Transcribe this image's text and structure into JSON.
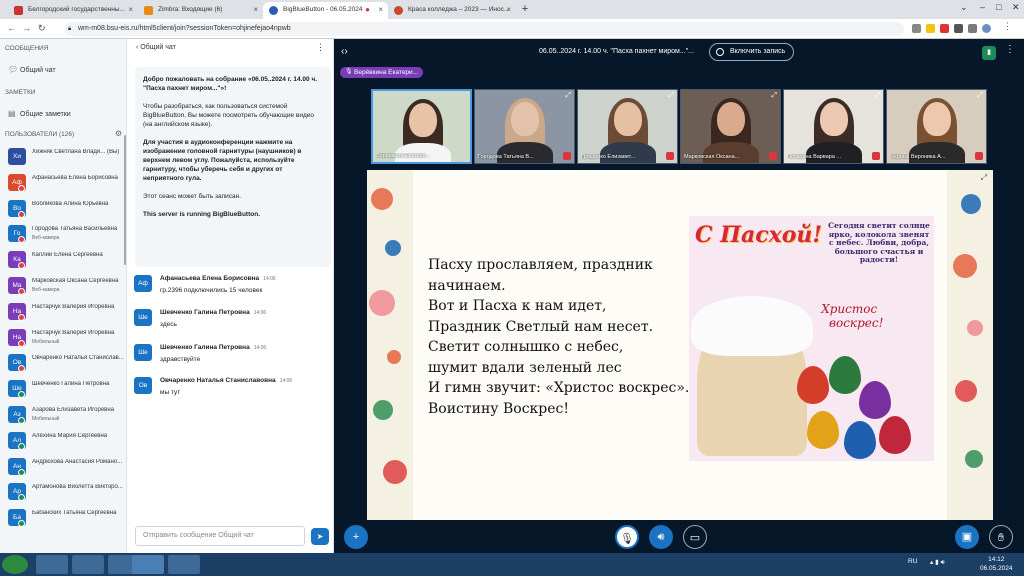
{
  "browser": {
    "tabs": [
      {
        "title": "Белгородский государственны...",
        "active": false
      },
      {
        "title": "Zimbra: Входящие (6)",
        "active": false
      },
      {
        "title": "BigBlueButton - 06.05.2024",
        "active": true
      },
      {
        "title": "Краса колледжа – 2023 — Инос...",
        "active": false
      }
    ],
    "url": "wm-m08.bsu-eis.ru/html5client/join?sessionToken=ohjinefejao4npwb"
  },
  "sidebar": {
    "messages_header": "СООБЩЕНИЯ",
    "public_chat": "Общий чат",
    "notes_header": "ЗАМЕТКИ",
    "shared_notes": "Общие заметки",
    "users_header": "ПОЛЬЗОВАТЕЛИ (126)",
    "users": [
      {
        "initials": "Хи",
        "name": "Хижняк Светлана Влади... (Вы)",
        "sub": "",
        "color": "#2b4ea0",
        "status": "none"
      },
      {
        "initials": "Аф",
        "name": "Афанасьева Елена Борисовна",
        "sub": "",
        "color": "#d94b2b",
        "status": "red"
      },
      {
        "initials": "Во",
        "name": "Вобликова Алина Юрьевна",
        "sub": "",
        "color": "#1b73c3",
        "status": "red"
      },
      {
        "initials": "Го",
        "name": "Городова Татьяна Васильевна",
        "sub": "Веб-камера",
        "color": "#1b73c3",
        "status": "red"
      },
      {
        "initials": "Ка",
        "name": "Каплий Елена Сергеевна",
        "sub": "",
        "color": "#7a3db8",
        "status": "red"
      },
      {
        "initials": "Ма",
        "name": "Марковская Оксана Сергеевна",
        "sub": "Веб-камера",
        "color": "#7a3db8",
        "status": "red"
      },
      {
        "initials": "На",
        "name": "Настарчук Валерия Игоревна",
        "sub": "",
        "color": "#7a3db8",
        "status": "red"
      },
      {
        "initials": "На",
        "name": "Настарчук Валерия Игоревна",
        "sub": "Мобильный",
        "color": "#7a3db8",
        "status": "red"
      },
      {
        "initials": "Ов",
        "name": "Овчаренко Наталья Станислав...",
        "sub": "",
        "color": "#1b73c3",
        "status": "red"
      },
      {
        "initials": "Ше",
        "name": "Шевченко Галина Петровна",
        "sub": "",
        "color": "#1b73c3",
        "status": "green"
      },
      {
        "initials": "Аз",
        "name": "Азарова Елизавета Игоревна",
        "sub": "Мобильный",
        "color": "#1b73c3",
        "status": "green"
      },
      {
        "initials": "Ал",
        "name": "Алёхина Мария Сергеевна",
        "sub": "",
        "color": "#1b73c3",
        "status": "green"
      },
      {
        "initials": "Ан",
        "name": "Андрюхова Анастасия Романо...",
        "sub": "",
        "color": "#1b73c3",
        "status": "green"
      },
      {
        "initials": "Ар",
        "name": "Артамонова Виолетта Викторо...",
        "sub": "",
        "color": "#1b73c3",
        "status": "green"
      },
      {
        "initials": "Ба",
        "name": "Бабанских Татьяна Сергеевна",
        "sub": "",
        "color": "#1b73c3",
        "status": "green"
      }
    ]
  },
  "chat": {
    "title": "Общий чат",
    "welcome": [
      "Добро пожаловать на собрание «06.05..2024 г. 14.00 ч. \"Пасха пахнет миром...\"»!",
      "Чтобы разобраться, как пользоваться системой BigBlueButton, Вы можете посмотреть обучающие видео (на английском языке).",
      "Для участия в аудиоконференции нажмите на изображение головной гарнитуры (наушников) в верхнем левом углу. Пожалуйста, используйте гарнитуру, чтобы уберечь себя и других от неприятного гула.",
      "Этот сеанс может быть записан.",
      "This server is running BigBlueButton."
    ],
    "messages": [
      {
        "initials": "Аф",
        "author": "Афанасьева Елена Борисовна",
        "time": "14:06",
        "text": "гр.2396 подключились 15 человек"
      },
      {
        "initials": "Ше",
        "author": "Шевченко Галина Петровна",
        "time": "14:06",
        "text": "здесь"
      },
      {
        "initials": "Ше",
        "author": "Шевченко Галина Петровна",
        "time": "14:06",
        "text": "здравствуйте"
      },
      {
        "initials": "Ов",
        "author": "Овчаренко Наталья Станиславовна",
        "time": "14:06",
        "text": "мы тут"
      }
    ],
    "input_placeholder": "Отправить сообщение Общий чат"
  },
  "stage": {
    "meeting_title": "06.05..2024 г. 14.00 ч. \"Пасха пахнет миром...\"...",
    "record_label": "Включить запись",
    "talking": "Верёвкина Екатери...",
    "videos": [
      {
        "name": "Верёвкина Екатери...",
        "bg": "#cfd9c8",
        "hair": "#3b2a22",
        "skin": "#e8c3a8",
        "shirt": "#f5f5f5"
      },
      {
        "name": "Городова Татьяна В...",
        "bg": "#8b95a3",
        "hair": "#caa98a",
        "skin": "#e2c2aa",
        "shirt": "#2a2a2e"
      },
      {
        "name": "Грищенко Елизавет...",
        "bg": "#cdd2cc",
        "hair": "#6b4a36",
        "skin": "#e5c0a2",
        "shirt": "#2f3a4a"
      },
      {
        "name": "Марковская Оксана...",
        "bg": "#6c5e55",
        "hair": "#3a2720",
        "skin": "#d9ab8c",
        "shirt": "#5a3d2e"
      },
      {
        "name": "Потапина Варвара ...",
        "bg": "#e6e2dc",
        "hair": "#3d2c25",
        "skin": "#ecc9b2",
        "shirt": "#1f1f24"
      },
      {
        "name": "Черных Вероника А...",
        "bg": "#d7cdbf",
        "hair": "#7a5232",
        "skin": "#edc8ae",
        "shirt": "#2a2a2a"
      }
    ],
    "poem": [
      "Пасху прославляем, праздник",
      "начинаем.",
      "Вот и Пасха к нам идет,",
      "Праздник Светлый нам несет.",
      "Светит солнышко с небес,",
      "шумит вдали зеленый лес",
      "И гимн звучит: «Христос воскрес».",
      "Воистину Воскрес!"
    ],
    "card": {
      "title": "С Пасхой!",
      "verse": "Сегодня светит солнце ярко, колокола звенят с небес. Любви, добра, большого счастья и радости!",
      "blessing_1": "Христос",
      "blessing_2": "воскрес!"
    }
  },
  "taskbar": {
    "lang": "RU",
    "time": "14:12",
    "date": "06.05.2024"
  }
}
